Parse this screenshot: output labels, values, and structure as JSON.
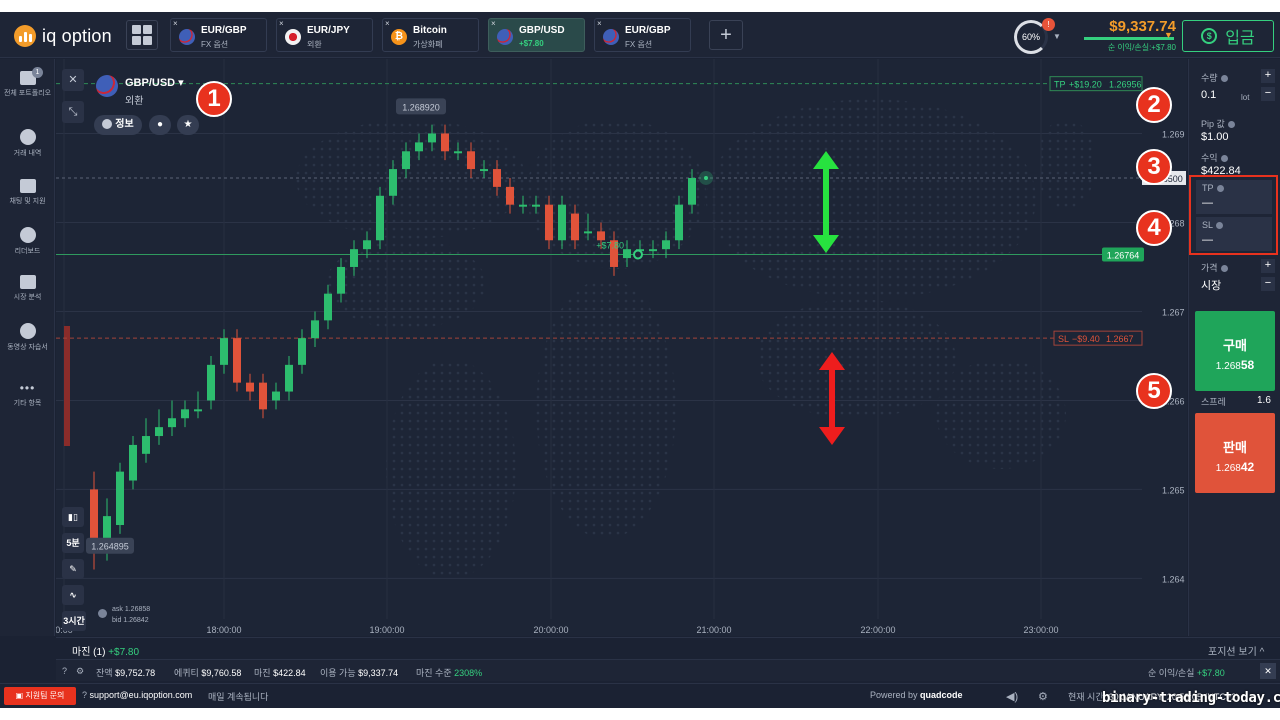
{
  "header": {
    "logo_text": "iq option",
    "tabs": [
      {
        "name": "EUR/GBP",
        "sub": "FX 옵션",
        "icon": "gb-flag-icon",
        "active": false
      },
      {
        "name": "EUR/JPY",
        "sub": "외환",
        "icon": "jp-flag-icon",
        "active": false
      },
      {
        "name": "Bitcoin",
        "sub": "가상화폐",
        "icon": "bitcoin-icon",
        "active": false
      },
      {
        "name": "GBP/USD",
        "sub": "+$7.80",
        "icon": "gb-us-flag-icon",
        "active": true
      },
      {
        "name": "EUR/GBP",
        "sub": "FX 옵션",
        "icon": "eu-gb-flag-icon",
        "active": false
      }
    ],
    "tab_close": "×",
    "add_tab": "+",
    "gauge_value": "60%",
    "gauge_badge": "!",
    "balance": "$9,337.74",
    "balance_pl": "순 이익/손실:+$7.80",
    "deposit_label": "입금",
    "deposit_icon": "$"
  },
  "sidebar": {
    "items": [
      {
        "label": "전체 포트폴리오",
        "icon": "portfolio-icon",
        "badge": "1"
      },
      {
        "label": "거래 내역",
        "icon": "clock-icon"
      },
      {
        "label": "채팅 및 지원",
        "icon": "chat-icon"
      },
      {
        "label": "리더보드",
        "icon": "medal-icon"
      },
      {
        "label": "시장 분석",
        "icon": "analysis-icon"
      },
      {
        "label": "동영상 자습서",
        "icon": "play-icon"
      },
      {
        "label": "기타 항목",
        "icon": "more-icon"
      }
    ],
    "more_glyph": "•••"
  },
  "asset": {
    "name": "GBP/USD",
    "category": "외환",
    "info_label": "정보",
    "close_glyph": "✕",
    "collapse_glyph": "⤡",
    "bell_glyph": "🔔",
    "star_glyph": "★"
  },
  "annotations": [
    "1",
    "2",
    "3",
    "4",
    "5"
  ],
  "chart_data": {
    "type": "candlestick",
    "x_ticks": [
      "0:00",
      "18:00:00",
      "19:00:00",
      "20:00:00",
      "21:00:00",
      "22:00:00",
      "23:00:00"
    ],
    "y_ticks": [
      "1.269",
      "1.268",
      "1.267",
      "1.266",
      "1.265",
      "1.264"
    ],
    "high_label": "1.268920",
    "low_label": "1.264895",
    "current_price": "1.268500",
    "entry_price": "1.26764",
    "tp_label": "TP",
    "tp_value": "+$19.20",
    "tp_price": "1.26956",
    "sl_label": "SL",
    "sl_value": "−$9.40",
    "sl_price": "1.2667",
    "position_pl": "+$7.80",
    "ask": "ask 1.26858",
    "bid": "bid 1.26842",
    "candles": [
      [
        1.265,
        1.2643,
        1.2652,
        1.2641
      ],
      [
        1.2643,
        1.2647,
        1.2649,
        1.2642
      ],
      [
        1.2646,
        1.2652,
        1.2653,
        1.2645
      ],
      [
        1.2651,
        1.2655,
        1.2656,
        1.265
      ],
      [
        1.2654,
        1.2656,
        1.2658,
        1.2653
      ],
      [
        1.2656,
        1.2657,
        1.2659,
        1.2655
      ],
      [
        1.2657,
        1.2658,
        1.266,
        1.2656
      ],
      [
        1.2658,
        1.2659,
        1.266,
        1.2657
      ],
      [
        1.2659,
        1.2659,
        1.2661,
        1.2658
      ],
      [
        1.266,
        1.2664,
        1.2665,
        1.2659
      ],
      [
        1.2664,
        1.2667,
        1.2668,
        1.2663
      ],
      [
        1.2667,
        1.2662,
        1.2668,
        1.2661
      ],
      [
        1.2662,
        1.2661,
        1.2663,
        1.266
      ],
      [
        1.2662,
        1.2659,
        1.2663,
        1.2658
      ],
      [
        1.266,
        1.2661,
        1.2662,
        1.2659
      ],
      [
        1.2661,
        1.2664,
        1.2665,
        1.266
      ],
      [
        1.2664,
        1.2667,
        1.2668,
        1.2663
      ],
      [
        1.2667,
        1.2669,
        1.267,
        1.2666
      ],
      [
        1.2669,
        1.2672,
        1.2673,
        1.2668
      ],
      [
        1.2672,
        1.2675,
        1.2676,
        1.2671
      ],
      [
        1.2675,
        1.2677,
        1.2678,
        1.2674
      ],
      [
        1.2677,
        1.2678,
        1.2679,
        1.2676
      ],
      [
        1.2678,
        1.2683,
        1.2684,
        1.2677
      ],
      [
        1.2683,
        1.2686,
        1.2687,
        1.2682
      ],
      [
        1.2686,
        1.2688,
        1.2689,
        1.2685
      ],
      [
        1.2688,
        1.2689,
        1.269,
        1.2687
      ],
      [
        1.2689,
        1.269,
        1.2691,
        1.2688
      ],
      [
        1.269,
        1.2688,
        1.2691,
        1.2687
      ],
      [
        1.2688,
        1.2688,
        1.2689,
        1.2687
      ],
      [
        1.2688,
        1.2686,
        1.2689,
        1.2685
      ],
      [
        1.2686,
        1.2686,
        1.2687,
        1.2685
      ],
      [
        1.2686,
        1.2684,
        1.2687,
        1.2683
      ],
      [
        1.2684,
        1.2682,
        1.2685,
        1.2681
      ],
      [
        1.2682,
        1.2682,
        1.2683,
        1.2681
      ],
      [
        1.2682,
        1.2682,
        1.2683,
        1.2681
      ],
      [
        1.2682,
        1.2678,
        1.2683,
        1.2677
      ],
      [
        1.2678,
        1.2682,
        1.2683,
        1.2677
      ],
      [
        1.2681,
        1.2678,
        1.2682,
        1.2677
      ],
      [
        1.2679,
        1.2679,
        1.2681,
        1.2678
      ],
      [
        1.2679,
        1.2678,
        1.268,
        1.2677
      ],
      [
        1.2678,
        1.2675,
        1.2679,
        1.2674
      ],
      [
        1.2676,
        1.2677,
        1.2678,
        1.2675
      ],
      [
        1.2677,
        1.2677,
        1.2678,
        1.2676
      ],
      [
        1.2677,
        1.2677,
        1.2678,
        1.2676
      ],
      [
        1.2677,
        1.2678,
        1.2679,
        1.2676
      ],
      [
        1.2678,
        1.2682,
        1.2683,
        1.2677
      ],
      [
        1.2682,
        1.2685,
        1.2686,
        1.2681
      ]
    ]
  },
  "right_panel": {
    "amount_label": "수량",
    "amount_value": "0.1",
    "amount_unit": "lot",
    "pip_label": "Pip 값",
    "pip_value": "$1.00",
    "profit_label": "수익",
    "profit_value": "$422.84",
    "tp_label": "TP",
    "tp_value": "—",
    "sl_label": "SL",
    "sl_value": "—",
    "price_label": "가격",
    "price_value": "시장",
    "buy_label": "구매",
    "buy_price_main": "1.268",
    "buy_price_big": "58",
    "spread_label": "스프레",
    "spread_value": "1.6",
    "sell_label": "판매",
    "sell_price_main": "1.268",
    "sell_price_big": "42",
    "plus": "+",
    "minus": "−"
  },
  "chart_tools": {
    "timeframe": "5분",
    "period": "3시간"
  },
  "positions_bar": {
    "tab_label": "마진 (1)",
    "tab_pl": "+$7.80",
    "view_label": "포지션 보기",
    "caret": "^"
  },
  "status_bar": {
    "balance_label": "잔액",
    "balance_value": "$9,752.78",
    "equity_label": "에퀴티",
    "equity_value": "$9,760.58",
    "margin_label": "마진",
    "margin_value": "$422.84",
    "available_label": "이용 가능",
    "available_value": "$9,337.74",
    "level_label": "마진 수준",
    "level_value": "2308%",
    "net_label": "순 이익/손실",
    "net_value": "+$7.80",
    "close_glyph": "✕"
  },
  "footer": {
    "support_label": "지원팀 문의",
    "email": "support@eu.iqoption.com",
    "message": "매일 계속됩니다",
    "powered": "Powered by",
    "brand": "quadcode",
    "time_prefix": "현재 시간:",
    "time_value": "30 JANUARY, 20:58:05 (UTC+2)",
    "watermark": "binary-trading-today.com"
  },
  "colors": {
    "background": "#1b2233",
    "green": "#35d07f",
    "red": "#e0533a",
    "orange": "#f39c2a",
    "annotation": "#e8321e"
  }
}
